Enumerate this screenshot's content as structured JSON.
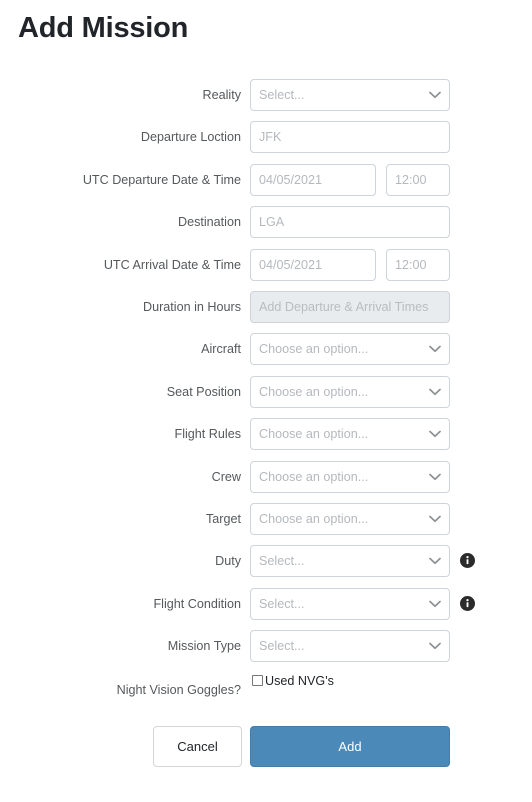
{
  "page": {
    "title": "Add Mission",
    "background_color": "#ffffff"
  },
  "theme": {
    "accent_color": "#4a89b8",
    "label_color": "#55595c",
    "placeholder_color": "#b5b9bd",
    "border_color": "#ced4da",
    "disabled_background": "#e9ecef"
  },
  "form": {
    "fields": [
      {
        "label": "Reality",
        "type": "select",
        "value": "Select...",
        "icon": "chevron-down-icon",
        "info_icon": false
      },
      {
        "label": "Departure Loction",
        "type": "text",
        "placeholder": "JFK",
        "info_icon": false
      },
      {
        "label": "UTC Departure Date & Time",
        "type": "date-time",
        "date_placeholder": "04/05/2021",
        "time_placeholder": "12:00",
        "info_icon": false
      },
      {
        "label": "Destination",
        "type": "text",
        "placeholder": "LGA",
        "info_icon": false
      },
      {
        "label": "UTC Arrival Date & Time",
        "type": "date-time",
        "date_placeholder": "04/05/2021",
        "time_placeholder": "12:00",
        "info_icon": false
      },
      {
        "label": "Duration in Hours",
        "type": "text-disabled",
        "placeholder": "Add Departure & Arrival Times",
        "info_icon": false
      },
      {
        "label": "Aircraft",
        "type": "select",
        "value": "Choose an option...",
        "icon": "chevron-down-icon",
        "info_icon": false
      },
      {
        "label": "Seat Position",
        "type": "select",
        "value": "Choose an option...",
        "icon": "chevron-down-icon",
        "info_icon": false
      },
      {
        "label": "Flight Rules",
        "type": "select",
        "value": "Choose an option...",
        "icon": "chevron-down-icon",
        "info_icon": false
      },
      {
        "label": "Crew",
        "type": "select",
        "value": "Choose an option...",
        "icon": "chevron-down-icon",
        "info_icon": false
      },
      {
        "label": "Target",
        "type": "select",
        "value": "Choose an option...",
        "icon": "chevron-down-icon",
        "info_icon": false
      },
      {
        "label": "Duty",
        "type": "select",
        "value": "Select...",
        "icon": "chevron-down-icon",
        "info_icon": true
      },
      {
        "label": "Flight Condition",
        "type": "select",
        "value": "Select...",
        "icon": "chevron-down-icon",
        "info_icon": true
      },
      {
        "label": "Mission Type",
        "type": "select",
        "value": "Select...",
        "icon": "chevron-down-icon",
        "info_icon": false
      }
    ],
    "checkbox_row": {
      "label": "Night Vision Goggles?",
      "checkbox_label": "Used NVG's",
      "checked": false
    }
  },
  "actions": {
    "cancel_label": "Cancel",
    "submit_label": "Add"
  }
}
